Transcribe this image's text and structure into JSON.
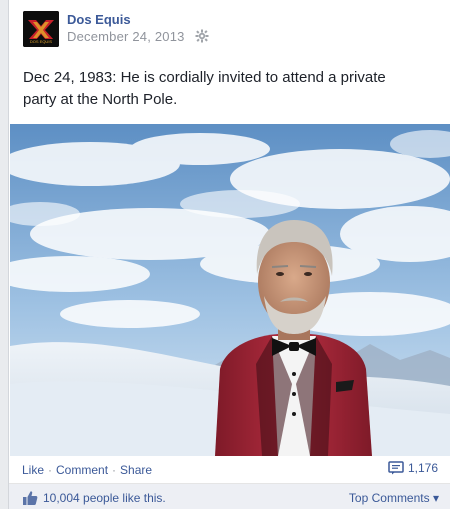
{
  "post": {
    "page_name": "Dos Equis",
    "date": "December 24, 2013",
    "text": "Dec 24, 1983: He is cordially invited to attend a private party at the North Pole.",
    "logo_text": "DOS EQUIS",
    "logo_icon": "dos-equis-logo"
  },
  "actions": {
    "like": "Like",
    "comment": "Comment",
    "share": "Share",
    "separator": "·",
    "comments_count": "1,176"
  },
  "likes": {
    "count": "10,004",
    "suffix": " people like this.",
    "top_comments": "Top Comments",
    "dropdown_glyph": "▾"
  },
  "colors": {
    "link": "#3b5998",
    "meta": "#90949c",
    "jacket": "#a8283a"
  }
}
